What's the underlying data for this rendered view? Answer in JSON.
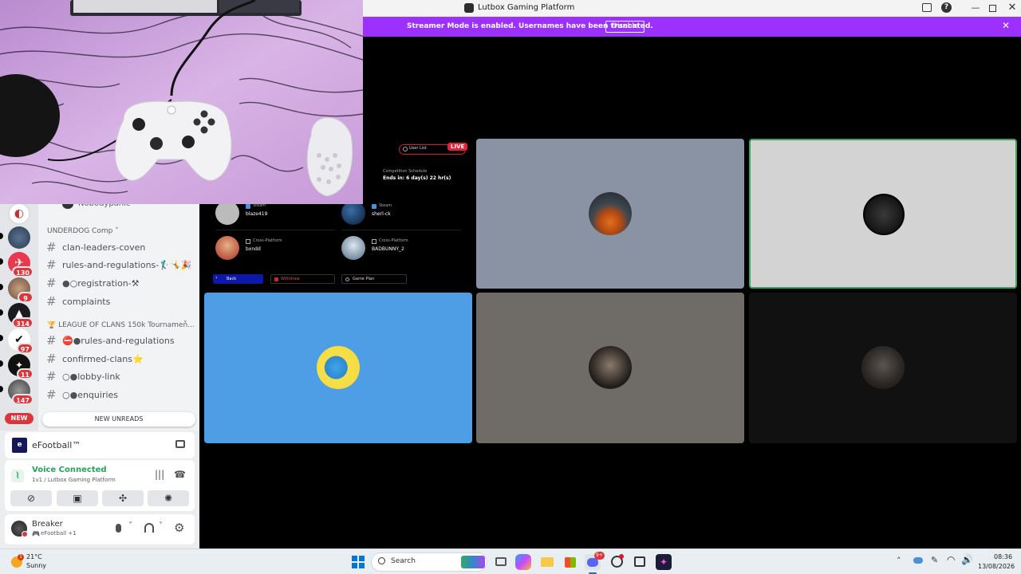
{
  "webcam": {
    "label": ""
  },
  "sidebar": {
    "partial_user": "Nobodypanic",
    "categories": [
      {
        "label": "UNDERDOG Comp"
      },
      {
        "label": "🏆 LEAGUE OF CLANS 150k Tournamen..."
      }
    ],
    "channels": [
      {
        "label": "clan-leaders-coven"
      },
      {
        "label": "rules-and-regulations-🏌️‍♂️🤸🎉"
      },
      {
        "label": "●○registration-⚒"
      },
      {
        "label": "complaints"
      },
      {
        "label": "⛔●rules-and-regulations"
      },
      {
        "label": "confirmed-clans⭐"
      },
      {
        "label": "○●lobby-link"
      },
      {
        "label": "○●enquiries"
      }
    ],
    "server_badges": [
      "130",
      "9",
      "314",
      "97",
      "11",
      "147"
    ],
    "new_pill": "NEW",
    "new_unreads": "NEW UNREADS"
  },
  "activity": {
    "game": "eFootball™"
  },
  "voice": {
    "status": "Voice Connected",
    "channel": "1v1 / Lutbox Gaming Platform"
  },
  "user": {
    "name": "Breaker",
    "status": "eFootball +1"
  },
  "lutbox": {
    "title": "Lutbox Gaming Platform",
    "banner_text": "Streamer Mode is enabled. Usernames have been truncated.",
    "banner_button": "Disable",
    "user_list": "User List",
    "live": "LIVE",
    "schedule_label": "Competition Schedule",
    "ends_in": "Ends in: 6 day(s) 22 hr(s)",
    "players": [
      {
        "platform": "Steam",
        "name": "blaze419"
      },
      {
        "platform": "Steam",
        "name": "sherl-ck"
      },
      {
        "platform": "Cross-Platform",
        "name": "bxndd"
      },
      {
        "platform": "Cross-Platform",
        "name": "BADBUNNY_2"
      }
    ],
    "buttons": {
      "back": "Back",
      "withdraw": "Withdraw",
      "game_plan": "Game Plan"
    }
  },
  "taskbar": {
    "weather_temp": "21°C",
    "weather_desc": "Sunny",
    "weather_badge": "1",
    "search": "Search",
    "discord_badge": "9+",
    "time": "08:36",
    "date": "13/08/2026"
  },
  "colors": {
    "streamer_banner": "#9b30ff",
    "voice_green": "#23a55a",
    "tile_blue": "#4e9ee5",
    "tile_grey": "#8a93a3",
    "tile_light": "#d3d3d3",
    "tile_taupe": "#6f6b66",
    "tile_dark": "#111111",
    "speaking_border": "#3ba55d"
  }
}
